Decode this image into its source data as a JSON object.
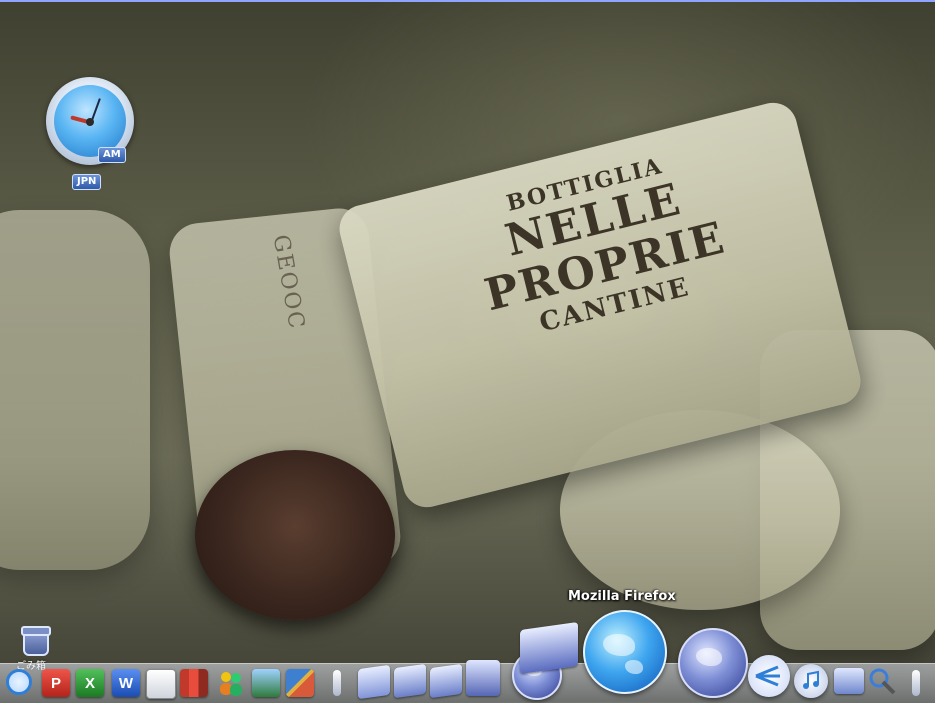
{
  "desktop": {
    "wallpaper": {
      "cork_text_lines": [
        "BOTTIGLIA",
        "NELLE",
        "PROPRIE",
        "CANTINE"
      ],
      "side_text": "GEOOC"
    },
    "clock_widget": {
      "period": "AM",
      "timezone": "JPN"
    },
    "trash": {
      "label": "ごみ箱"
    },
    "tooltip": "Mozilla Firefox"
  },
  "dock": {
    "items": [
      {
        "name": "dock-finder-icon"
      },
      {
        "name": "dock-powerpoint-icon",
        "letter": "P"
      },
      {
        "name": "dock-excel-icon",
        "letter": "X"
      },
      {
        "name": "dock-word-icon",
        "letter": "W"
      },
      {
        "name": "dock-document-icon"
      },
      {
        "name": "dock-books-icon"
      },
      {
        "name": "dock-users-icon"
      },
      {
        "name": "dock-photo-icon"
      },
      {
        "name": "dock-paint-icon"
      },
      {
        "name": "dock-mail-icon"
      },
      {
        "name": "dock-monitor-icon"
      },
      {
        "name": "dock-monitor2-icon"
      },
      {
        "name": "dock-drive-icon"
      },
      {
        "name": "dock-globe-icon"
      },
      {
        "name": "dock-screens-icon"
      },
      {
        "name": "dock-firefox-icon"
      },
      {
        "name": "dock-globe2-icon"
      },
      {
        "name": "dock-network-icon"
      },
      {
        "name": "dock-music-icon"
      },
      {
        "name": "dock-display-icon"
      },
      {
        "name": "dock-tools-icon"
      }
    ]
  },
  "colors": {
    "accent": "#2e7fd6",
    "top_line": "#8ea4ff"
  }
}
